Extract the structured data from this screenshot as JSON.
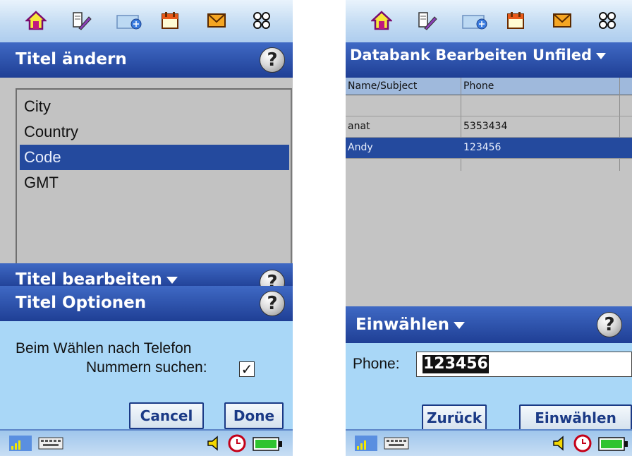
{
  "left": {
    "title": "Titel ändern",
    "list": [
      "City",
      "Country",
      "Code",
      "GMT"
    ],
    "selected": "Code",
    "edit_label": "Titel bearbeiten",
    "options_title": "Titel Optionen",
    "option_line1": "Beim Wählen nach Telefon",
    "option_line2": "Nummern suchen:",
    "option_checked": true,
    "cancel_label": "Cancel",
    "done_label": "Done"
  },
  "right": {
    "title": "Databank Bearbeiten Unfiled",
    "columns": [
      "Name/Subject",
      "Phone"
    ],
    "rows": [
      {
        "name": "",
        "phone": ""
      },
      {
        "name": "anat",
        "phone": "5353434"
      },
      {
        "name": "Andy",
        "phone": "123456"
      }
    ],
    "selected_row": "Andy",
    "dial_title": "Einwählen",
    "phone_label": "Phone:",
    "phone_value": "123456",
    "back_label": "Zurück",
    "dial_label": "Einwählen"
  },
  "icons": [
    "home-icon",
    "tools-icon",
    "connect-icon",
    "calendar-icon",
    "mail-icon",
    "apps-icon",
    "help-icon",
    "signal-icon",
    "keyboard-icon",
    "speaker-icon",
    "clock-icon",
    "battery-icon"
  ],
  "colors": {
    "titlebar": "#1f3f95",
    "selection": "#244a9e",
    "panel": "#a9d7f7",
    "list_bg": "#c4c4c4"
  }
}
